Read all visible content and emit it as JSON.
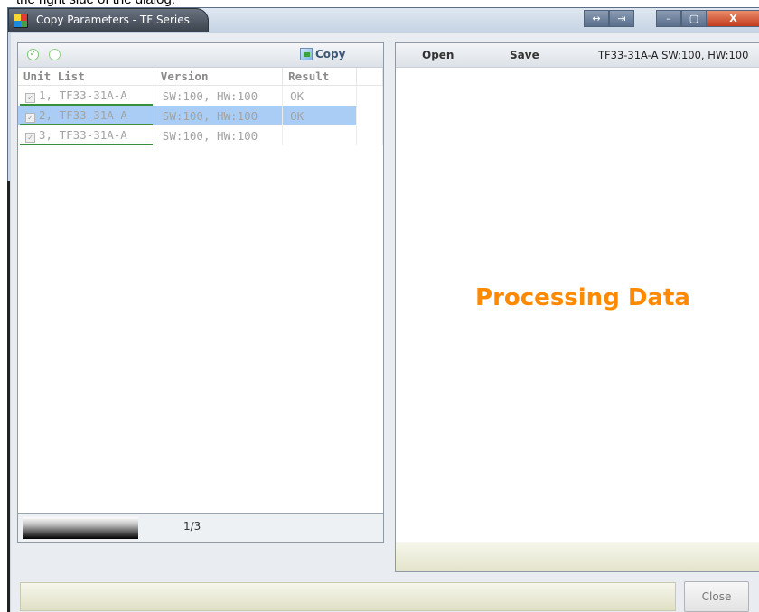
{
  "caption_fragment": "the right side of the dialog.",
  "window": {
    "title": "Copy Parameters - TF Series",
    "controls": [
      "↔",
      "⇥",
      "–",
      "▢",
      "X"
    ]
  },
  "left_panel": {
    "toolbar": {
      "copy_label": "Copy"
    },
    "columns": [
      "Unit List",
      "Version",
      "Result"
    ],
    "rows": [
      {
        "unit": "1, TF33-31A-A",
        "version": "SW:100, HW:100",
        "result": "OK",
        "checked": true,
        "selected": false
      },
      {
        "unit": "2, TF33-31A-A",
        "version": "SW:100, HW:100",
        "result": "OK",
        "checked": true,
        "selected": true
      },
      {
        "unit": "3, TF33-31A-A",
        "version": "SW:100, HW:100",
        "result": "",
        "checked": true,
        "selected": false
      }
    ],
    "page_indicator": "1/3"
  },
  "right_panel": {
    "open_label": "Open",
    "save_label": "Save",
    "device_info": "TF33-31A-A  SW:100, HW:100",
    "processing_text": "Processing Data"
  },
  "footer": {
    "close_label": "Close"
  },
  "colors": {
    "accent_orange": "#ff8a00",
    "selected_row": "#a9cdf5",
    "underline_green": "#3a8f3a"
  }
}
